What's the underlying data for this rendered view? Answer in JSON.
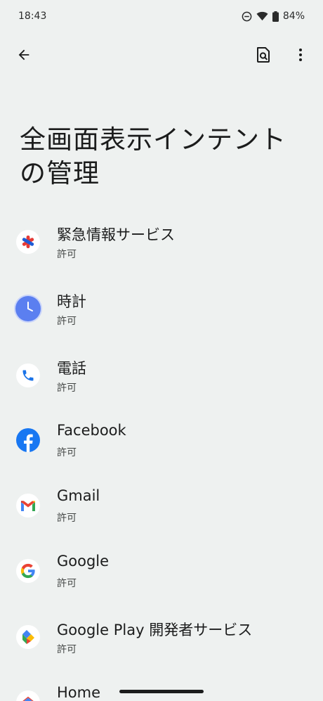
{
  "status_bar": {
    "time": "18:43",
    "battery": "84%",
    "icons": [
      "dnd-icon",
      "wifi-icon",
      "battery-icon"
    ]
  },
  "toolbar": {
    "back_icon": "arrow-back-icon",
    "search_icon": "search-settings-icon",
    "more_icon": "more-vert-icon"
  },
  "page": {
    "title_line1": "全画面表示インテント",
    "title_line2": "の管理"
  },
  "apps": [
    {
      "name": "緊急情報サービス",
      "status": "許可",
      "icon": "emergency-info-icon"
    },
    {
      "name": "時計",
      "status": "許可",
      "icon": "clock-icon"
    },
    {
      "name": "電話",
      "status": "許可",
      "icon": "phone-icon"
    },
    {
      "name": "Facebook",
      "status": "許可",
      "icon": "facebook-icon"
    },
    {
      "name": "Gmail",
      "status": "許可",
      "icon": "gmail-icon"
    },
    {
      "name": "Google",
      "status": "許可",
      "icon": "google-icon"
    },
    {
      "name": "Google Play 開発者サービス",
      "status": "許可",
      "icon": "play-services-icon"
    },
    {
      "name": "Home",
      "status": "",
      "icon": "home-icon"
    }
  ],
  "colors": {
    "background": "#eef1f0",
    "text_primary": "#1b1c1c",
    "text_secondary": "#444746",
    "clock_blue": "#5b7ff0",
    "phone_blue": "#1a73e8",
    "facebook_blue": "#1877f2",
    "emergency_red": "#e53935"
  }
}
